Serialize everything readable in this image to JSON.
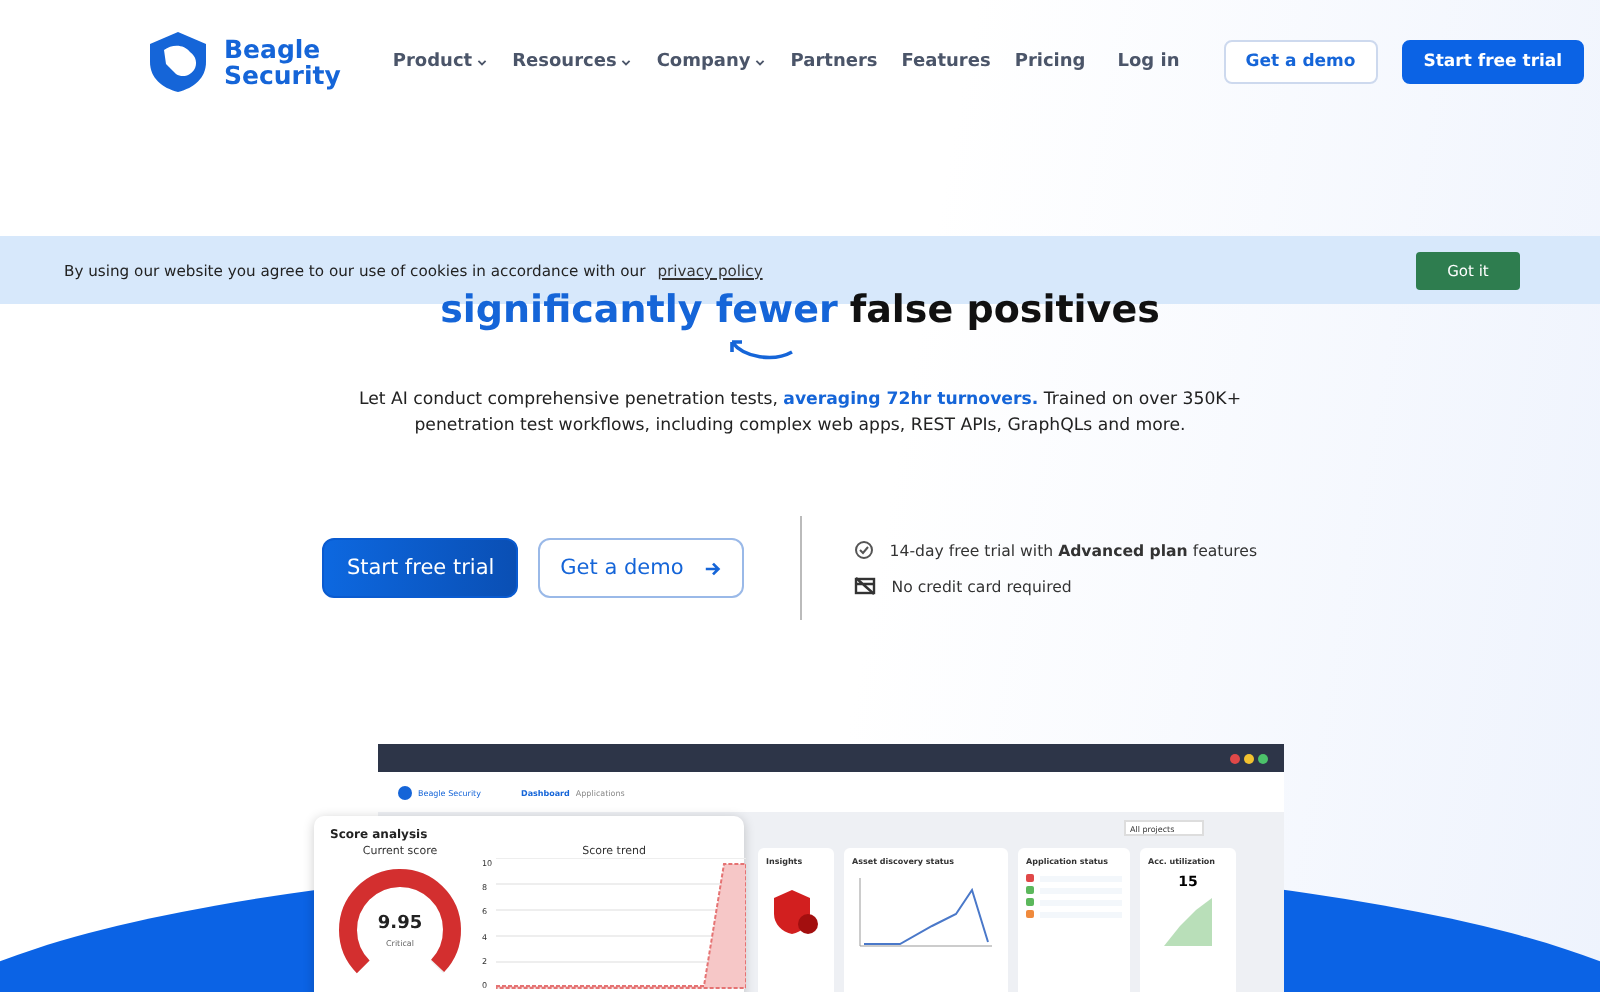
{
  "nav": {
    "logo": [
      "Beagle",
      "Security"
    ],
    "links": [
      {
        "label": "Product",
        "dropdown": true
      },
      {
        "label": "Resources",
        "dropdown": true
      },
      {
        "label": "Company",
        "dropdown": true
      },
      {
        "label": "Partners",
        "dropdown": false
      },
      {
        "label": "Features",
        "dropdown": false
      },
      {
        "label": "Pricing",
        "dropdown": false
      }
    ],
    "login": "Log in",
    "demo": "Get a demo",
    "trial": "Start free trial"
  },
  "cookie": {
    "text": "By using our website you agree to our use of cookies in accordance with our",
    "link": "privacy policy",
    "button": "Got it"
  },
  "hero": {
    "headline_accent": "significantly fewer",
    "headline_rest": "false positives",
    "body": "Let AI conduct comprehensive penetration tests, **averaging 72hr turnovers.** Trained on over 350K+ penetration test workflows, including complex web apps, REST APIs, GraphQLs and more.",
    "trial": "Start free trial",
    "demo": "Get a demo",
    "perks": [
      {
        "kind": "check",
        "text": "14-day free trial with **Advanced plan** features"
      },
      {
        "kind": "card",
        "text": "No credit card required"
      }
    ]
  },
  "dashboard": {
    "logo": [
      "Beagle",
      "Security"
    ],
    "tabs": [
      {
        "label": "Dashboard",
        "selected": true
      },
      {
        "label": "Applications",
        "selected": false
      }
    ],
    "filter": "All projects",
    "score": {
      "title": "Score analysis",
      "current": "Current score",
      "value": "9.95",
      "severity": "Critical",
      "trend": "Score trend",
      "yticks": [
        "10",
        "8",
        "6",
        "4",
        "2",
        "0"
      ]
    },
    "insights": "Insights",
    "asset": "Asset discovery status",
    "app_status": {
      "title": "Application status",
      "items": [
        {
          "color": "#e04848"
        },
        {
          "color": "#5cb85c"
        },
        {
          "color": "#5cb85c"
        },
        {
          "color": "#f08a3c"
        }
      ]
    },
    "acc": {
      "title": "Acc. utilization",
      "value": "15"
    }
  }
}
